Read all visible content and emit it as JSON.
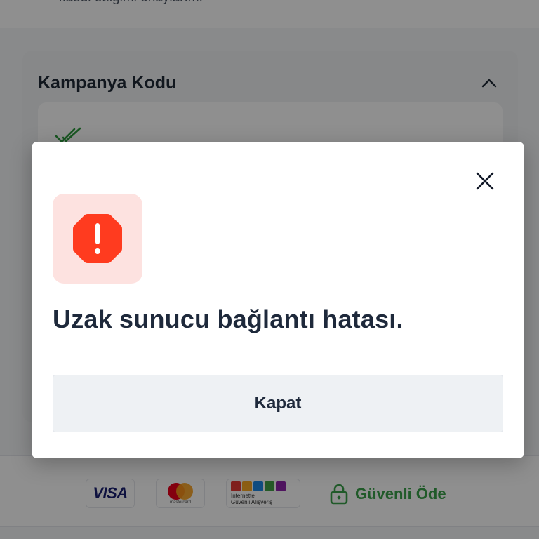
{
  "background": {
    "consent_text": "kabul ettiğimi onaylarım.",
    "promo": {
      "title": "Kampanya Kodu"
    },
    "footer": {
      "visa_label": "VISA",
      "mastercard_label": "mastercard",
      "trust_line1": "İnternette",
      "trust_line2": "Güvenli Alışveriş",
      "secure_label": "Güvenli Öde"
    }
  },
  "modal": {
    "message": "Uzak sunucu bağlantı hatası.",
    "close_button_label": "Kapat",
    "icons": {
      "alert": "octagon-exclamation-icon",
      "close": "close-icon"
    }
  },
  "colors": {
    "error": "#ff3b1f",
    "error_bg": "#fde2e0",
    "secure_green": "#3aa14a",
    "text_dark": "#1e293b",
    "button_bg": "#eef1f4"
  }
}
